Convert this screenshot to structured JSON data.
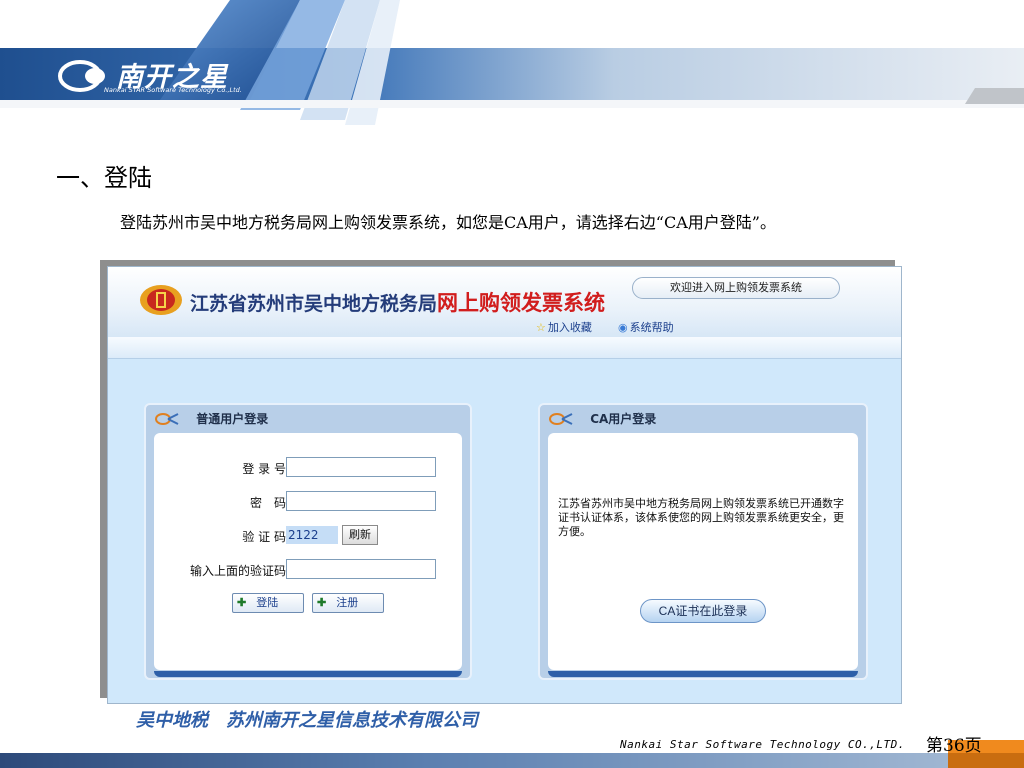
{
  "slide": {
    "logo_cn": "南开之星",
    "logo_en": "Nankai STAR Software Technology Co.,Ltd.",
    "section_title": "一、登陆",
    "description": "登陆苏州市吴中地方税务局网上购领发票系统，如您是CA用户，请选择右边“CA用户登陆”。",
    "company": "吴中地税　苏州南开之星信息技术有限公司",
    "footer_en": "Nankai Star Software Technology CO.,LTD.",
    "page_number": "第36页"
  },
  "system": {
    "title_main": "江苏省苏州市吴中地方税务局",
    "title_highlight": "网上购领发票系统",
    "welcome": "欢迎进入网上购领发票系统",
    "links": {
      "favorite": "加入收藏",
      "help": "系统帮助"
    }
  },
  "normal_login": {
    "header": "普通用户登录",
    "username_label": "登 录 号:",
    "username_value": "",
    "password_label": "密　码:",
    "password_value": "",
    "captcha_label": "验 证 码:",
    "captcha_value": "2122",
    "refresh_button": "刷新",
    "captcha_input_label": "输入上面的验证码:",
    "captcha_input_value": "",
    "login_button": "登陆",
    "register_button": "注册"
  },
  "ca_login": {
    "header": "CA用户登录",
    "description": "江苏省苏州市吴中地方税务局网上购领发票系统已开通数字证书认证体系，该体系使您的网上购领发票系统更安全，更方便。",
    "login_button": "CA证书在此登录"
  },
  "colors": {
    "accent_blue": "#2d5fa8",
    "title_red": "#d11d1d",
    "page_bg": "#d0e8fb",
    "footer_orange": "#f08a1e"
  }
}
